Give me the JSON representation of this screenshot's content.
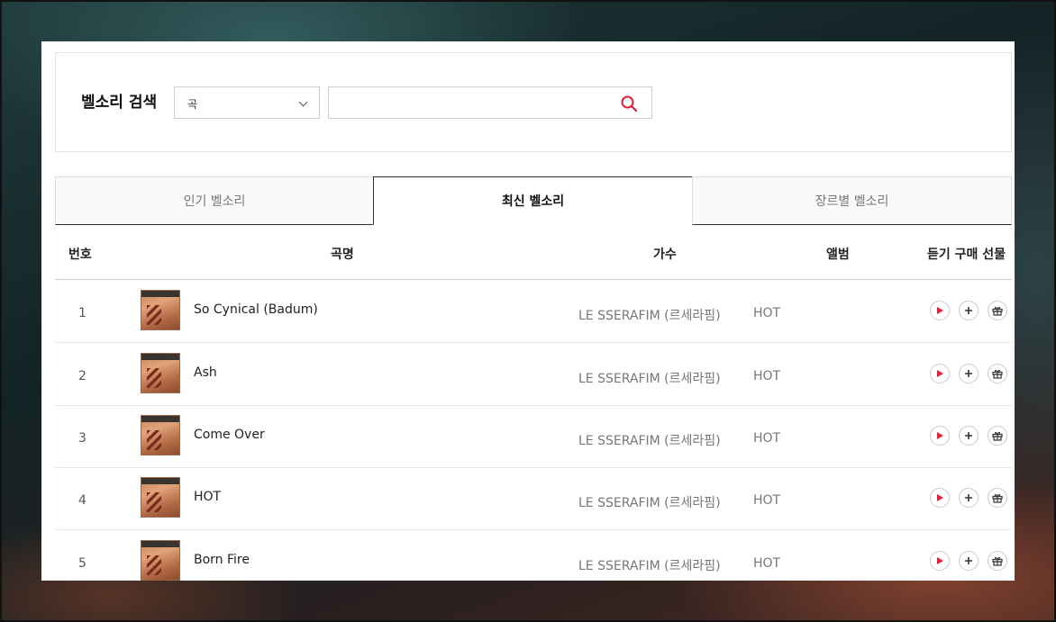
{
  "search": {
    "title": "벨소리 검색",
    "type_selected": "곡",
    "query": ""
  },
  "tabs": [
    {
      "label": "인기 벨소리",
      "active": false
    },
    {
      "label": "최신 벨소리",
      "active": true
    },
    {
      "label": "장르별 벨소리",
      "active": false
    }
  ],
  "table": {
    "headers": {
      "number": "번호",
      "song": "곡명",
      "artist": "가수",
      "album": "앨범",
      "actions": "듣기 구매 선물"
    },
    "rows": [
      {
        "number": "1",
        "title": "So Cynical (Badum)",
        "artist": "LE SSERAFIM (르세라핌)",
        "album": "HOT"
      },
      {
        "number": "2",
        "title": "Ash",
        "artist": "LE SSERAFIM (르세라핌)",
        "album": "HOT"
      },
      {
        "number": "3",
        "title": "Come Over",
        "artist": "LE SSERAFIM (르세라핌)",
        "album": "HOT"
      },
      {
        "number": "4",
        "title": "HOT",
        "artist": "LE SSERAFIM (르세라핌)",
        "album": "HOT"
      },
      {
        "number": "5",
        "title": "Born Fire",
        "artist": "LE SSERAFIM (르세라핌)",
        "album": "HOT"
      }
    ]
  },
  "icons": {
    "search": "search-icon",
    "dropdown": "chevron-down-icon",
    "play": "play-icon",
    "buy": "plus-icon",
    "gift": "gift-icon"
  },
  "colors": {
    "accent": "#e0213c",
    "tab_border": "#2b2b3b"
  }
}
